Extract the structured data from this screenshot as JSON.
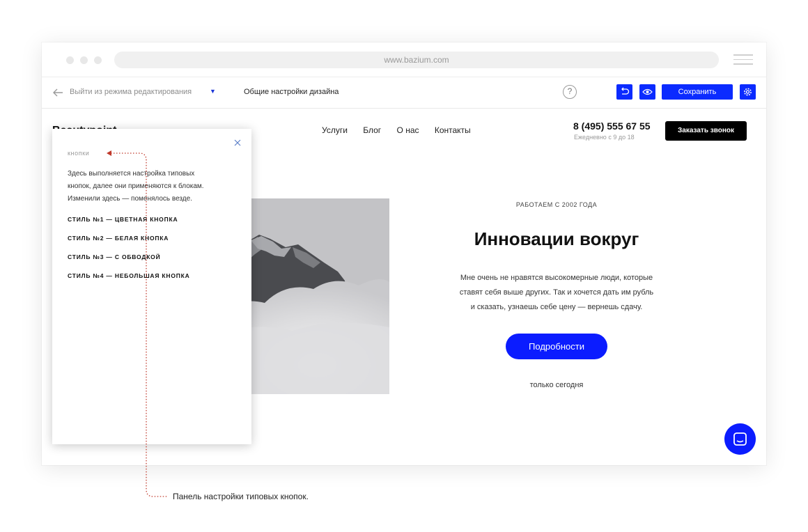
{
  "browser": {
    "url": "www.bazium.com"
  },
  "editor_toolbar": {
    "exit_label": "Выйти из режима редактирования",
    "design_settings_label": "Общие настройки дизайна",
    "help_label": "?",
    "save_label": "Сохранить",
    "accent_color": "#0b2bff"
  },
  "site": {
    "logo": "Beautypoint",
    "nav": [
      "Услуги",
      "Блог",
      "О нас",
      "Контакты"
    ],
    "phone": "8 (495) 555 67 55",
    "hours": "Ежедневно с 9 до 18",
    "call_button": "Заказать звонок"
  },
  "hero": {
    "since": "РАБОТАЕМ С 2002 ГОДА",
    "title": "Инновации вокруг",
    "text_lines": [
      "Мне очень не нравятся высокомерные люди, которые",
      "ставят себя выше других. Так и хочется дать им рубль",
      "и сказать, узнаешь себе цену — вернешь сдачу."
    ],
    "button": "Подробности",
    "note": "только сегодня"
  },
  "panel": {
    "title": "кнопки",
    "desc_lines": [
      "Здесь выполняется настройка типовых",
      "кнопок, далее они применяются к блокам.",
      "Изменили здесь — поменялось везде."
    ],
    "styles": [
      "СТИЛЬ №1  — ЦВЕТНАЯ КНОПКА",
      "СТИЛЬ №2  — БЕЛАЯ КНОПКА",
      "СТИЛЬ №3  — С ОБВОДКОЙ",
      "СТИЛЬ №4  — НЕБОЛЬШАЯ КНОПКА"
    ]
  },
  "annotation": {
    "text": "Панель настройки типовых кнопок.",
    "color": "#c0392b"
  }
}
